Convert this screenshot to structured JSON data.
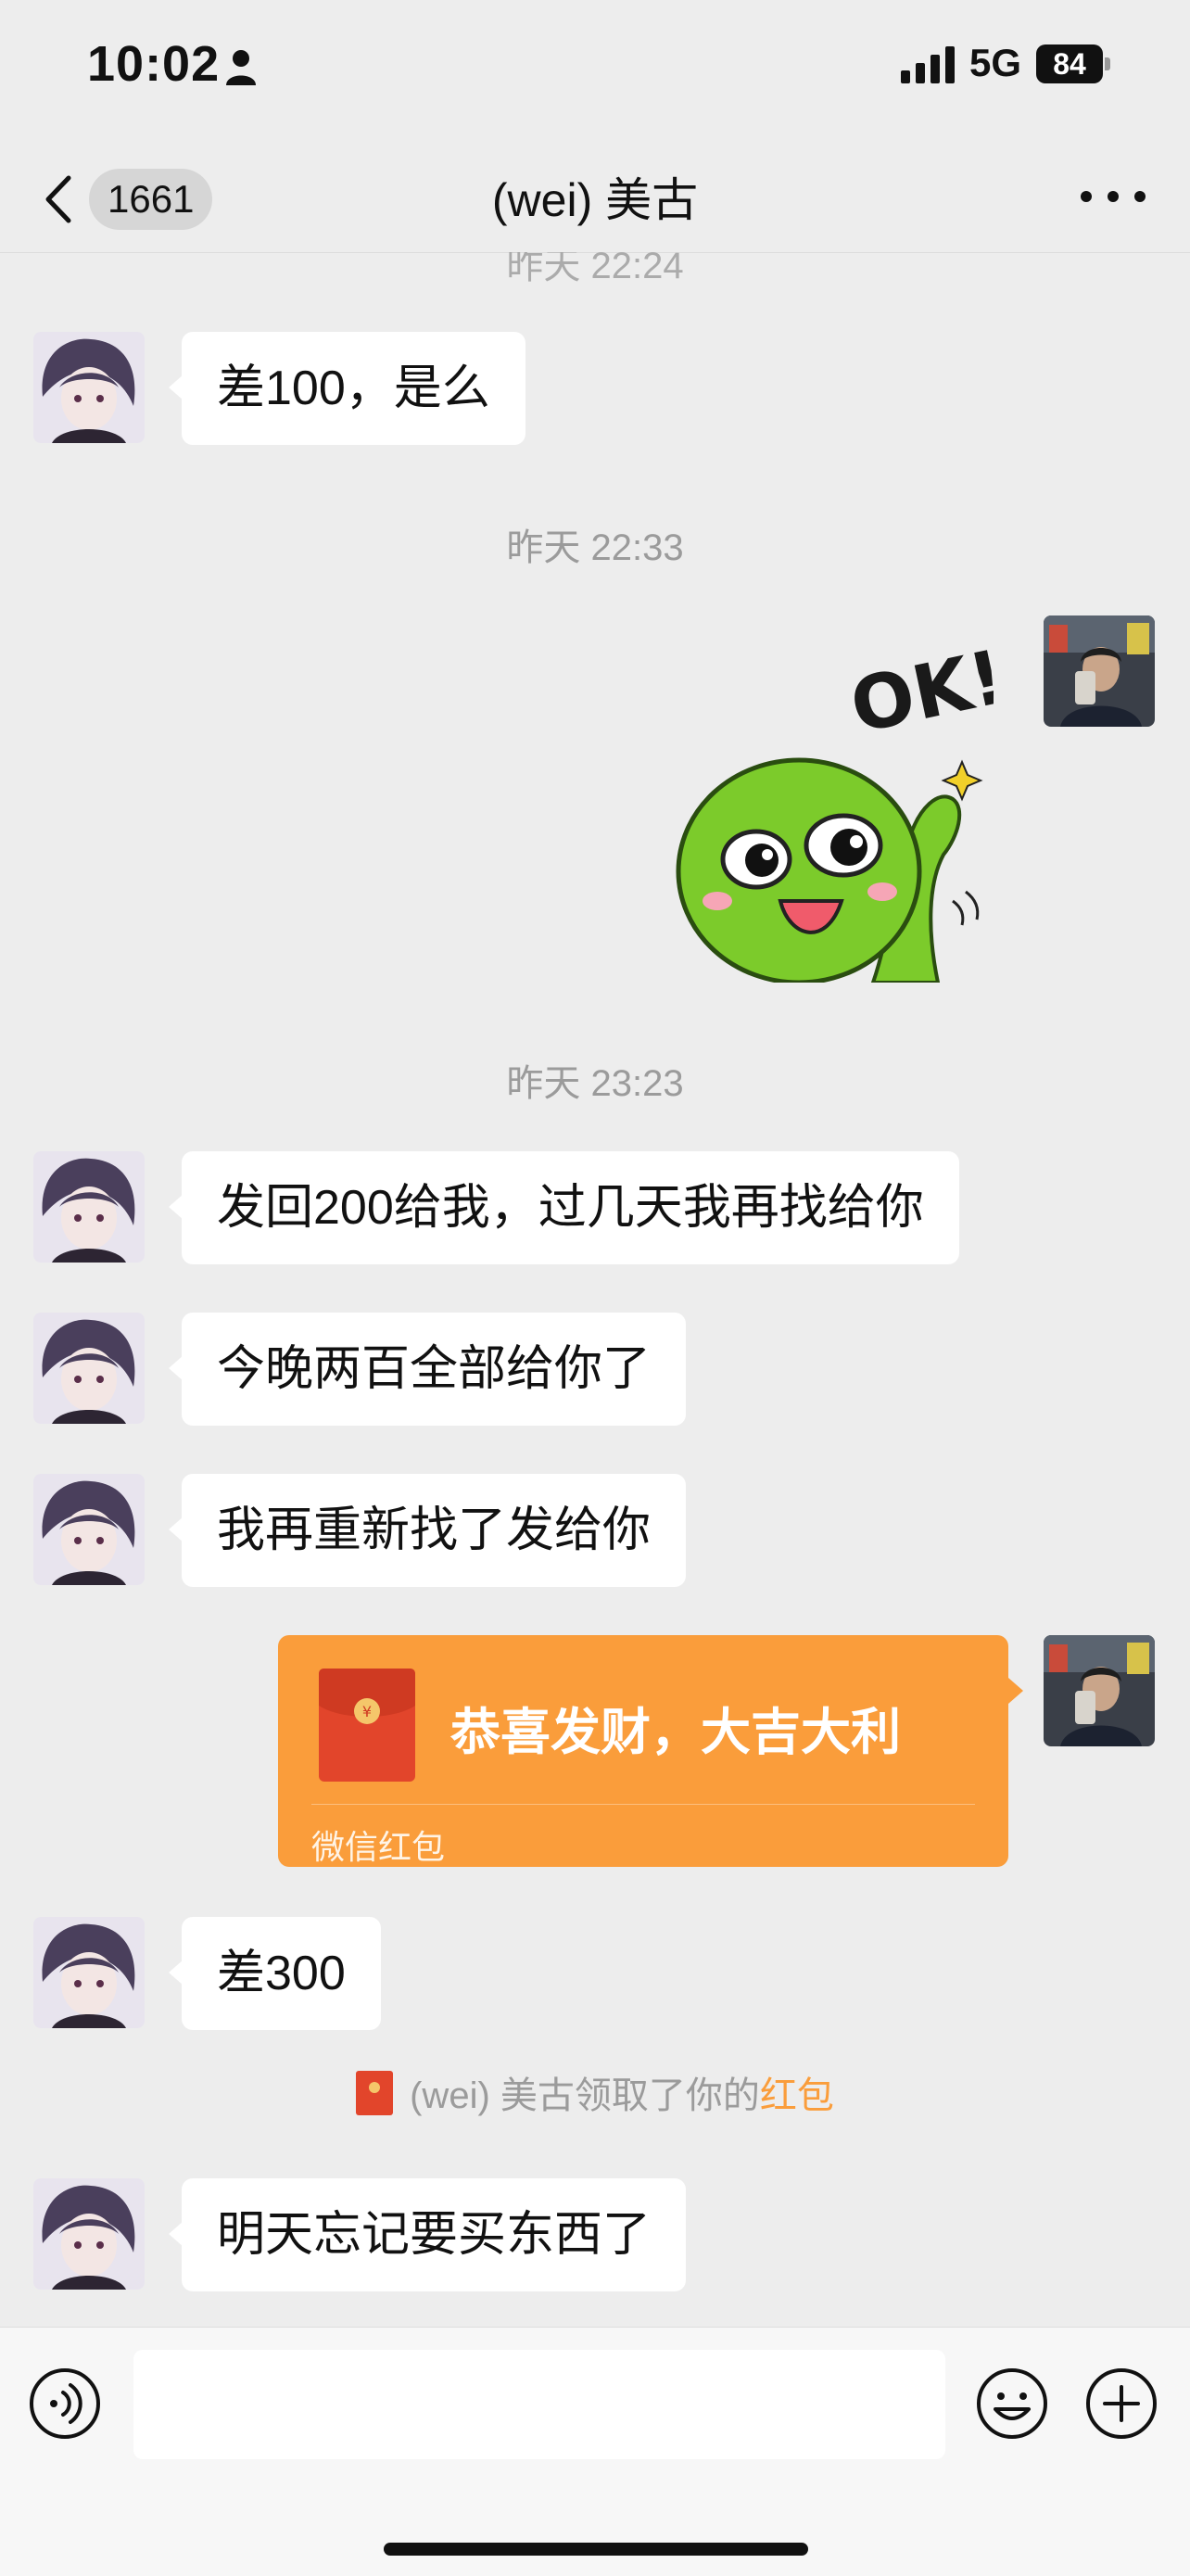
{
  "status_bar": {
    "time": "10:02",
    "network": "5G",
    "battery": "84",
    "icons": [
      "person-icon",
      "signal-icon",
      "battery-icon"
    ]
  },
  "nav": {
    "unread_count": "1661",
    "title": "(wei)  美古",
    "icons": [
      "back-chevron-icon",
      "more-icon"
    ]
  },
  "chat": {
    "timestamp_partial": "昨天 22:24",
    "timestamp_1": "昨天 22:33",
    "timestamp_2": "昨天 23:23",
    "messages": [
      {
        "sender": "contact",
        "text": "差100，是么"
      },
      {
        "sender": "me",
        "type": "sticker",
        "sticker_text": "OK!"
      },
      {
        "sender": "contact",
        "text": "发回200给我，过几天我再找给你"
      },
      {
        "sender": "contact",
        "text": "今晚两百全部给你了"
      },
      {
        "sender": "contact",
        "text": "我再重新找了发给你"
      },
      {
        "sender": "me",
        "type": "red-packet",
        "title": "恭喜发财，大吉大利",
        "label": "微信红包"
      },
      {
        "sender": "contact",
        "text": "差300"
      },
      {
        "sender": "contact",
        "text": "明天忘记要买东西了"
      }
    ],
    "system_note": {
      "prefix": "(wei)  美古领取了你的",
      "link": "红包"
    }
  },
  "input_bar": {
    "placeholder": "",
    "icons": [
      "voice-icon",
      "emoji-icon",
      "plus-icon"
    ]
  },
  "colors": {
    "background": "#ededed",
    "bubble": "#ffffff",
    "red_packet": "#fa9d3b",
    "red_packet_icon": "#e2452b",
    "timestamp_text": "#9b9b9b"
  }
}
